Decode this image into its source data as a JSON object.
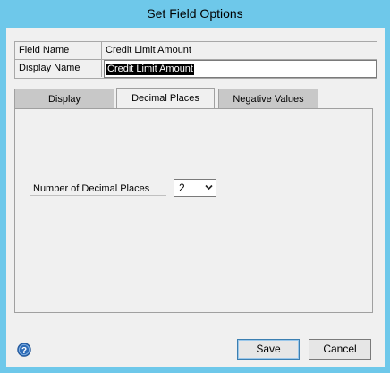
{
  "window": {
    "title": "Set Field Options"
  },
  "fields": {
    "field_name_label": "Field Name",
    "field_name_value": "Credit Limit Amount",
    "display_name_label": "Display Name",
    "display_name_value": "Credit Limit Amount"
  },
  "tabs": [
    {
      "label": "Display",
      "active": false
    },
    {
      "label": "Decimal Places",
      "active": true
    },
    {
      "label": "Negative Values",
      "active": false
    }
  ],
  "decimal_places": {
    "label": "Number of Decimal Places",
    "selected": "2"
  },
  "footer": {
    "help_icon": "help-icon",
    "save_label": "Save",
    "cancel_label": "Cancel"
  },
  "colors": {
    "titlebar": "#6ec8ea",
    "client": "#f0f0f0",
    "selection": "#000000"
  }
}
